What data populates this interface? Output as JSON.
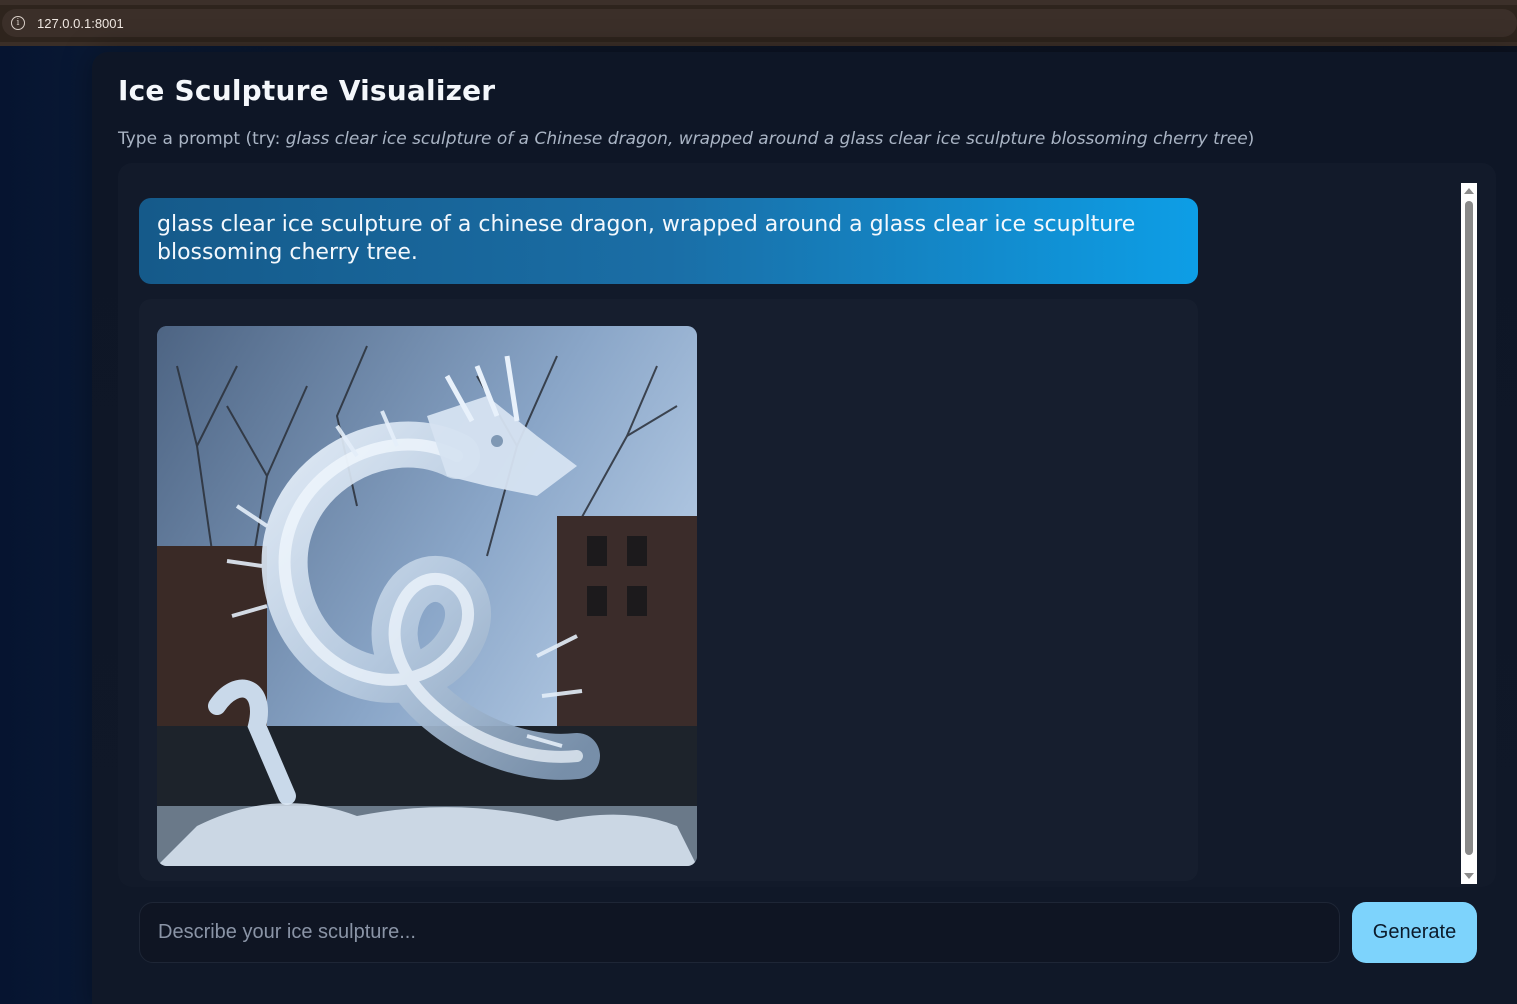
{
  "browser": {
    "url": "127.0.0.1:8001"
  },
  "header": {
    "title": "Ice Sculpture Visualizer",
    "subtitle_prefix": "Type a prompt (try: ",
    "subtitle_example": "glass clear ice sculpture of a Chinese dragon, wrapped around a glass clear ice sculpture blossoming cherry tree",
    "subtitle_suffix": ")"
  },
  "chat": {
    "messages": [
      {
        "role": "user",
        "text": "glass clear ice sculpture of a chinese dragon, wrapped around a glass clear ice scuplture blossoming cherry tree."
      },
      {
        "role": "assistant",
        "image": "ice-dragon-sculpture-image"
      }
    ]
  },
  "composer": {
    "placeholder": "Describe your ice sculpture...",
    "value": "",
    "generate_label": "Generate"
  },
  "colors": {
    "accent": "#7dd3fc",
    "user_bubble_start": "#155a8a",
    "user_bubble_end": "#0d9ee6",
    "background": "#0c1220"
  }
}
